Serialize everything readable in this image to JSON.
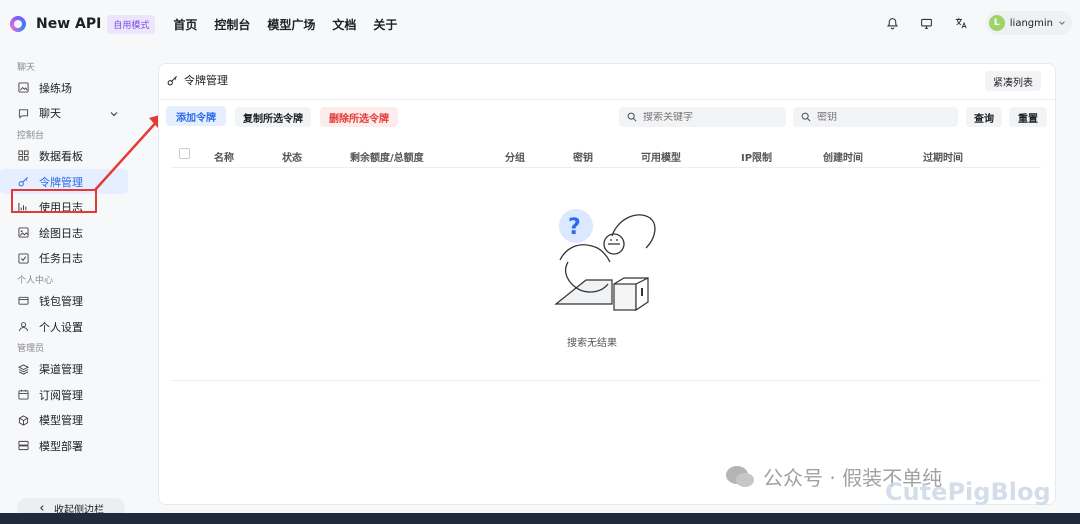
{
  "header": {
    "app_name": "New API",
    "mode_badge": "自用模式",
    "nav": [
      "首页",
      "控制台",
      "模型广场",
      "文档",
      "关于"
    ],
    "user": {
      "avatar_letter": "L",
      "name": "liangmin"
    }
  },
  "sidebar": {
    "sections": [
      {
        "title": "聊天",
        "items": [
          {
            "label": "操练场",
            "icon": "image-icon"
          },
          {
            "label": "聊天",
            "icon": "chat-bubble-icon",
            "has_chevron": true
          }
        ]
      },
      {
        "title": "控制台",
        "items": [
          {
            "label": "数据看板",
            "icon": "dashboard-grid-icon"
          },
          {
            "label": "令牌管理",
            "icon": "key-icon",
            "active": true
          },
          {
            "label": "使用日志",
            "icon": "bar-chart-icon"
          },
          {
            "label": "绘图日志",
            "icon": "picture-icon"
          },
          {
            "label": "任务日志",
            "icon": "checkbox-icon"
          }
        ]
      },
      {
        "title": "个人中心",
        "items": [
          {
            "label": "钱包管理",
            "icon": "wallet-icon"
          },
          {
            "label": "个人设置",
            "icon": "user-icon"
          }
        ]
      },
      {
        "title": "管理员",
        "items": [
          {
            "label": "渠道管理",
            "icon": "layers-icon"
          },
          {
            "label": "订阅管理",
            "icon": "calendar-icon"
          },
          {
            "label": "模型管理",
            "icon": "cube-icon"
          },
          {
            "label": "模型部署",
            "icon": "server-icon"
          }
        ]
      }
    ],
    "collapse_label": "收起侧边栏"
  },
  "main": {
    "title": "令牌管理",
    "compact_label": "紧凑列表",
    "buttons": {
      "add": "添加令牌",
      "copy": "复制所选令牌",
      "delete": "删除所选令牌"
    },
    "search": {
      "keyword_placeholder": "搜索关键字",
      "key_placeholder": "密钥",
      "query": "查询",
      "reset": "重置"
    },
    "columns": [
      "名称",
      "状态",
      "剩余额度/总额度",
      "分组",
      "密钥",
      "可用模型",
      "IP限制",
      "创建时间",
      "过期时间"
    ],
    "empty_text": "搜索无结果"
  },
  "watermark": {
    "text": "公众号 · 假装不单纯",
    "brand": "CutePigBlog"
  },
  "colors": {
    "accent": "#2c6bec",
    "danger": "#e53935",
    "badge": "#7c4ee4"
  }
}
